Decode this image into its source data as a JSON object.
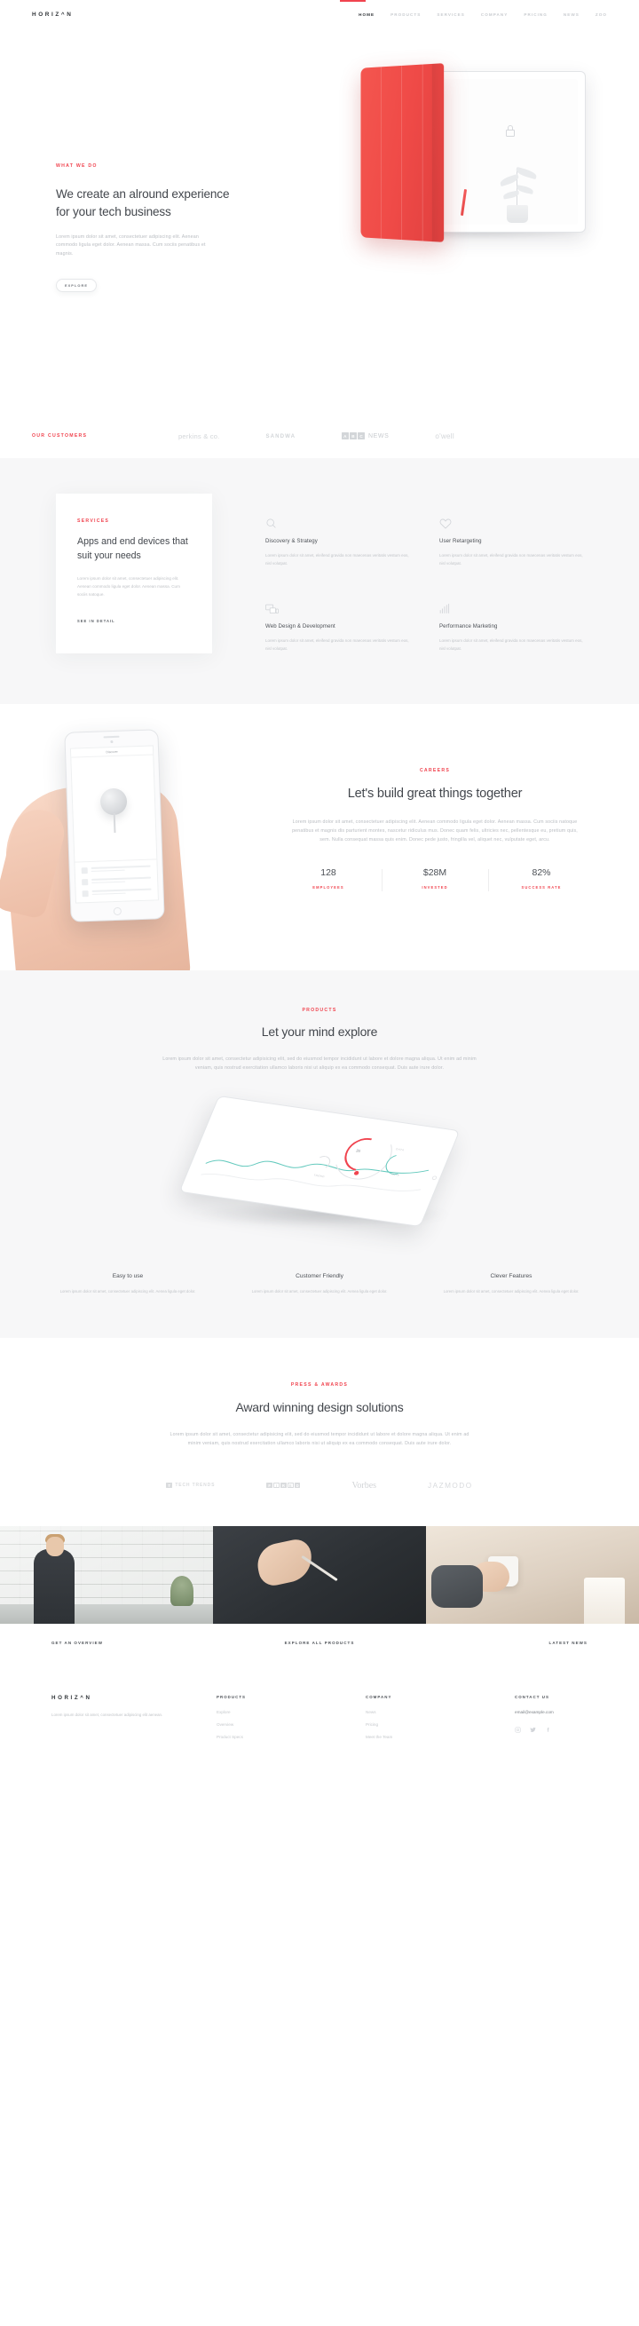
{
  "brand": {
    "name": "HORIZ^N",
    "name_plain": "HORIZON"
  },
  "nav": {
    "items": [
      {
        "label": "HOME",
        "active": true
      },
      {
        "label": "PRODUCTS",
        "active": false
      },
      {
        "label": "SERVICES",
        "active": false
      },
      {
        "label": "COMPANY",
        "active": false
      },
      {
        "label": "PRICING",
        "active": false
      },
      {
        "label": "NEWS",
        "active": false
      },
      {
        "label": "ZOO",
        "active": false
      }
    ]
  },
  "hero": {
    "eyebrow": "WHAT WE DO",
    "heading": "We create an alround experience for your tech business",
    "paragraph": "Lorem ipsum dolor sit amet, consectetuer adipiscing elit. Aenean commodo ligula eget dolor. Aenean massa. Cum sociis penatibus et magnis.",
    "button": "EXPLORE"
  },
  "customers": {
    "eyebrow": "OUR CUSTOMERS",
    "logos": [
      {
        "name": "perkins & co.",
        "type": "wordmark"
      },
      {
        "name": "SANDWA",
        "type": "wordmark-bold"
      },
      {
        "name": "ABC NEWS",
        "type": "abc"
      },
      {
        "name": "o'well",
        "type": "wordmark"
      }
    ],
    "abc_letters": [
      "A",
      "B",
      "C"
    ],
    "abc_word": "NEWS"
  },
  "services": {
    "card": {
      "eyebrow": "SERVICES",
      "heading": "Apps and end devices that suit your needs",
      "paragraph": "Lorem ipsum dolor sit amet, consectetuer adipiscing elit. Aenean commodo ligula eget dolor. Aenean massa. Cum sociis natoque.",
      "link": "SEE IN DETAIL"
    },
    "items": [
      {
        "icon": "search-icon",
        "title": "Discovery & Strategy",
        "text": "Lorem ipsum dolor sit amet, eleifend gravida non maecenas veritatis vestum eos, nisl volutpat."
      },
      {
        "icon": "heart-icon",
        "title": "User Retargeting",
        "text": "Lorem ipsum dolor sit amet, eleifend gravida non maecenas veritatis vestum eos, nisl volutpat."
      },
      {
        "icon": "devices-icon",
        "title": "Web Design & Development",
        "text": "Lorem ipsum dolor sit amet, eleifend gravida non maecenas veritatis vestum eos, nisl volutpat."
      },
      {
        "icon": "bar-chart-icon",
        "title": "Performance Marketing",
        "text": "Lorem ipsum dolor sit amet, eleifend gravida non maecenas veritatis vestum eos, nisl volutpat."
      }
    ]
  },
  "careers": {
    "eyebrow": "CAREERS",
    "heading": "Let's build great things together",
    "paragraph": "Lorem ipsum dolor sit amet, consectetuer adipiscing elit. Aenean commodo ligula eget dolor. Aenean massa. Cum sociis natoque penatibus et magnis dis parturient montes, nascetur ridiculus mus. Donec quam felis, ultricies nec, pellentesque eu, pretium quis, sem. Nulla consequat massa quis enim. Donec pede justo, fringilla vel, aliquet nec, vulputate eget, arcu.",
    "stats": [
      {
        "value": "128",
        "label": "EMPLOYEES"
      },
      {
        "value": "$28M",
        "label": "INVESTED"
      },
      {
        "value": "82%",
        "label": "SUCCESS RATE"
      }
    ],
    "phone_screen": {
      "title": "Discover"
    }
  },
  "products": {
    "eyebrow": "PRODUCTS",
    "heading": "Let your mind explore",
    "paragraph": "Lorem ipsum dolor sit amet, consectetur adipisicing elit, sed do eiusmod tempor incididunt ut labore et dolore magna aliqua. Ut enim ad minim veniam, quis nostrud exercitation ullamco laboris nisi ut aliquip ex ea commodo consequat. Duis aute irure dolor.",
    "dashboard": {
      "big_number": "36",
      "label_a": "DATA",
      "label_b": "RATE",
      "label_c": "TREND"
    },
    "features": [
      {
        "title": "Easy to use",
        "text": "Lorem ipsum dolor sit amet, consectetuer adipiscing elit. Aenea ligula eget dolor."
      },
      {
        "title": "Customer Friendly",
        "text": "Lorem ipsum dolor sit amet, consectetuer adipiscing elit. Aenea ligula eget dolor."
      },
      {
        "title": "Clever Features",
        "text": "Lorem ipsum dolor sit amet, consectetuer adipiscing elit. Aenea ligula eget dolor."
      }
    ]
  },
  "press": {
    "eyebrow": "PRESS & AWARDS",
    "heading": "Award winning design solutions",
    "paragraph": "Lorem ipsum dolor sit amet, consectetur adipisicing elit, sed do eiusmod tempor incididunt ut labore et dolore magna aliqua. Ut enim ad minim veniam, quis nostrud exercitation ullamco laboris nisi ut aliquip ex ea commodo consequat. Duis aute irure dolor.",
    "awards": [
      {
        "name": "TECH TRENDS",
        "mark": "T"
      },
      {
        "name": "FIRED",
        "letters": [
          "F",
          "I",
          "R",
          "E",
          "D"
        ]
      },
      {
        "name": "Vorbes"
      },
      {
        "name": "JAZMODO"
      }
    ]
  },
  "cta": {
    "items": [
      {
        "label": "GET AN OVERVIEW"
      },
      {
        "label": "EXPLORE ALL PRODUCTS"
      },
      {
        "label": "LATEST NEWS"
      }
    ]
  },
  "footer": {
    "logo": "HORIZ^N",
    "tagline": "Lorem ipsum dolor sit amet, consectetuer adipiscing elit aenean.",
    "columns": [
      {
        "heading": "PRODUCTS",
        "links": [
          "Explore",
          "Overview",
          "Product Specs"
        ]
      },
      {
        "heading": "COMPANY",
        "links": [
          "News",
          "Pricing",
          "Meet the Team"
        ]
      }
    ],
    "contact": {
      "heading": "CONTACT US",
      "email": "email@example.com",
      "socials": [
        "instagram-icon",
        "twitter-icon",
        "facebook-icon"
      ]
    }
  },
  "colors": {
    "accent": "#f0444f",
    "heading": "#43474d",
    "muted": "#c1c4c8",
    "panel": "#f7f7f8"
  }
}
